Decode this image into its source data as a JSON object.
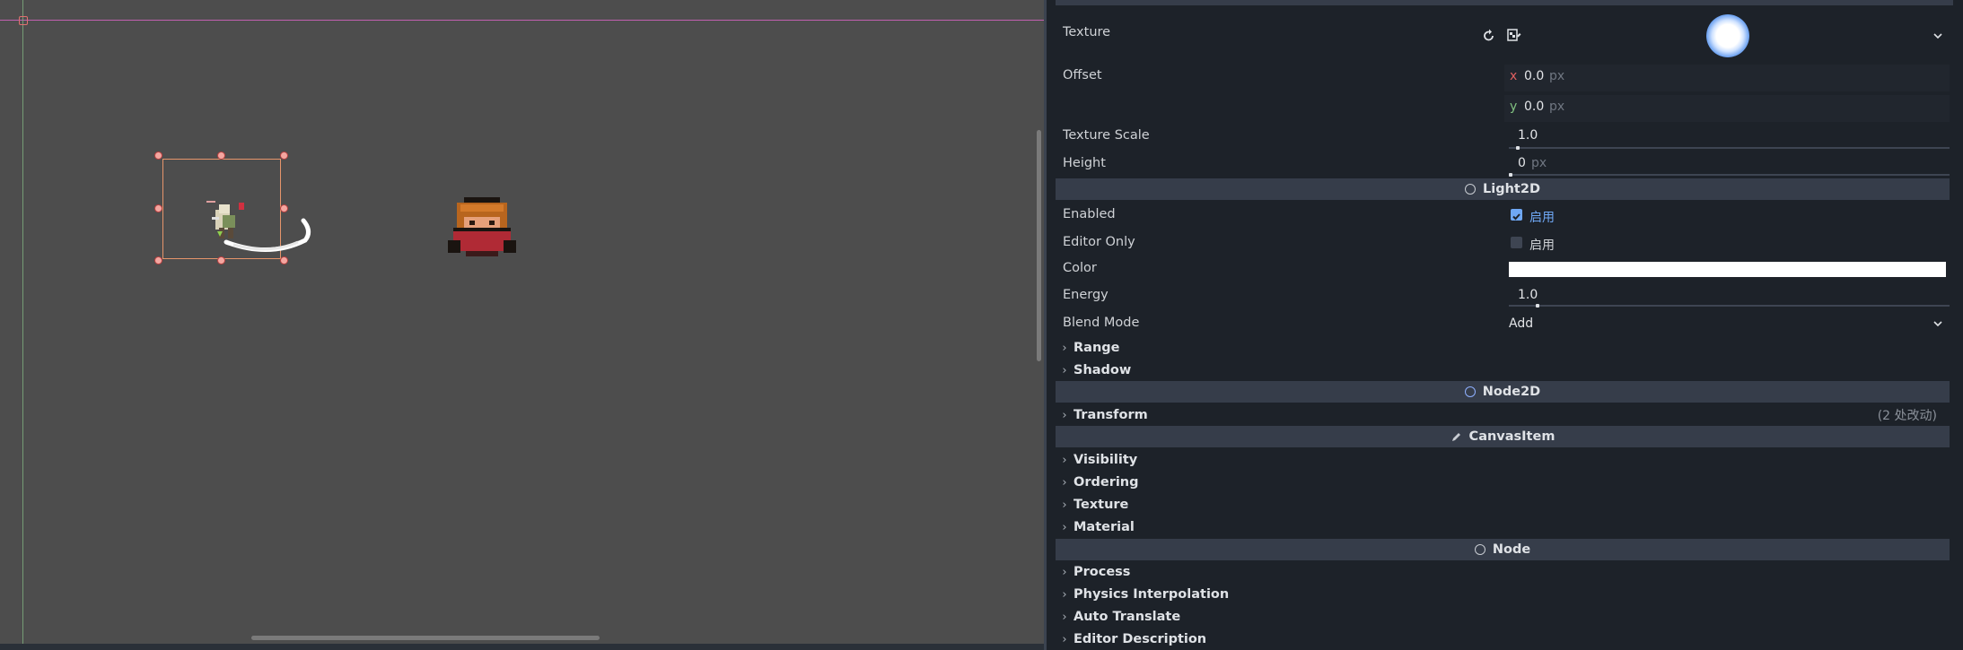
{
  "texture": {
    "label": "Texture"
  },
  "offset": {
    "label": "Offset",
    "x_axis": "x",
    "x_value": "0.0",
    "y_axis": "y",
    "y_value": "0.0",
    "unit": "px"
  },
  "texture_scale": {
    "label": "Texture Scale",
    "value": "1.0"
  },
  "height": {
    "label": "Height",
    "value": "0",
    "unit": "px"
  },
  "light2d": {
    "title": "Light2D",
    "enabled": {
      "label": "Enabled",
      "checked": true,
      "text": "启用"
    },
    "editor_only": {
      "label": "Editor Only",
      "checked": false,
      "text": "启用"
    },
    "color": {
      "label": "Color",
      "value_hex": "#ffffff"
    },
    "energy": {
      "label": "Energy",
      "value": "1.0"
    },
    "blend_mode": {
      "label": "Blend Mode",
      "value": "Add"
    },
    "groups": [
      "Range",
      "Shadow"
    ]
  },
  "node2d": {
    "title": "Node2D",
    "transform": {
      "label": "Transform",
      "modified": "(2 处改动)"
    }
  },
  "canvas_item": {
    "title": "CanvasItem",
    "groups": [
      "Visibility",
      "Ordering",
      "Texture",
      "Material"
    ]
  },
  "node": {
    "title": "Node",
    "groups": [
      "Process",
      "Physics Interpolation",
      "Auto Translate",
      "Editor Description"
    ]
  },
  "colors": {
    "accent": "#8fb0ff",
    "checkbox_on": "#6fa8f5",
    "header_bg": "#363d4a",
    "panel_bg": "#1d2229",
    "viewport_bg": "#4d4d4d"
  }
}
